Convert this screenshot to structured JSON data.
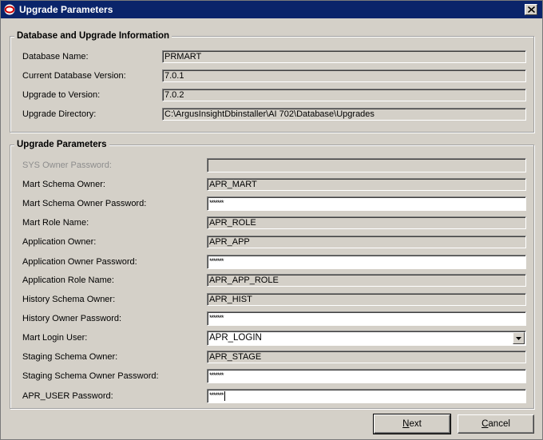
{
  "window": {
    "title": "Upgrade Parameters",
    "close_label": "×"
  },
  "db_group": {
    "title": "Database and Upgrade Information",
    "fields": [
      {
        "label": "Database Name:",
        "value": "PRMART"
      },
      {
        "label": "Current Database Version:",
        "value": "7.0.1"
      },
      {
        "label": "Upgrade to Version:",
        "value": "7.0.2"
      },
      {
        "label": "Upgrade Directory:",
        "value": "C:\\ArgusInsightDbinstaller\\AI 702\\Database\\Upgrades"
      }
    ]
  },
  "params_group": {
    "title": "Upgrade Parameters",
    "fields": [
      {
        "label": "SYS Owner Password:",
        "value": ""
      },
      {
        "label": "Mart Schema Owner:",
        "value": "APR_MART"
      },
      {
        "label": "Mart Schema Owner Password:",
        "value": "*******"
      },
      {
        "label": "Mart Role Name:",
        "value": "APR_ROLE"
      },
      {
        "label": "Application Owner:",
        "value": "APR_APP"
      },
      {
        "label": "Application Owner Password:",
        "value": "*******"
      },
      {
        "label": "Application Role Name:",
        "value": "APR_APP_ROLE"
      },
      {
        "label": "History Schema Owner:",
        "value": "APR_HIST"
      },
      {
        "label": "History Owner Password:",
        "value": "*******"
      },
      {
        "label": "Mart Login User:",
        "value": "APR_LOGIN"
      },
      {
        "label": "Staging Schema Owner:",
        "value": "APR_STAGE"
      },
      {
        "label": "Staging Schema Owner Password:",
        "value": "*******"
      },
      {
        "label": "APR_USER Password:",
        "value": "*******"
      }
    ]
  },
  "buttons": {
    "next": {
      "mnemonic": "N",
      "rest": "ext"
    },
    "cancel": {
      "mnemonic": "C",
      "rest": "ancel"
    }
  },
  "colors": {
    "titlebar": "#0a246a",
    "face": "#d4d0c8"
  }
}
